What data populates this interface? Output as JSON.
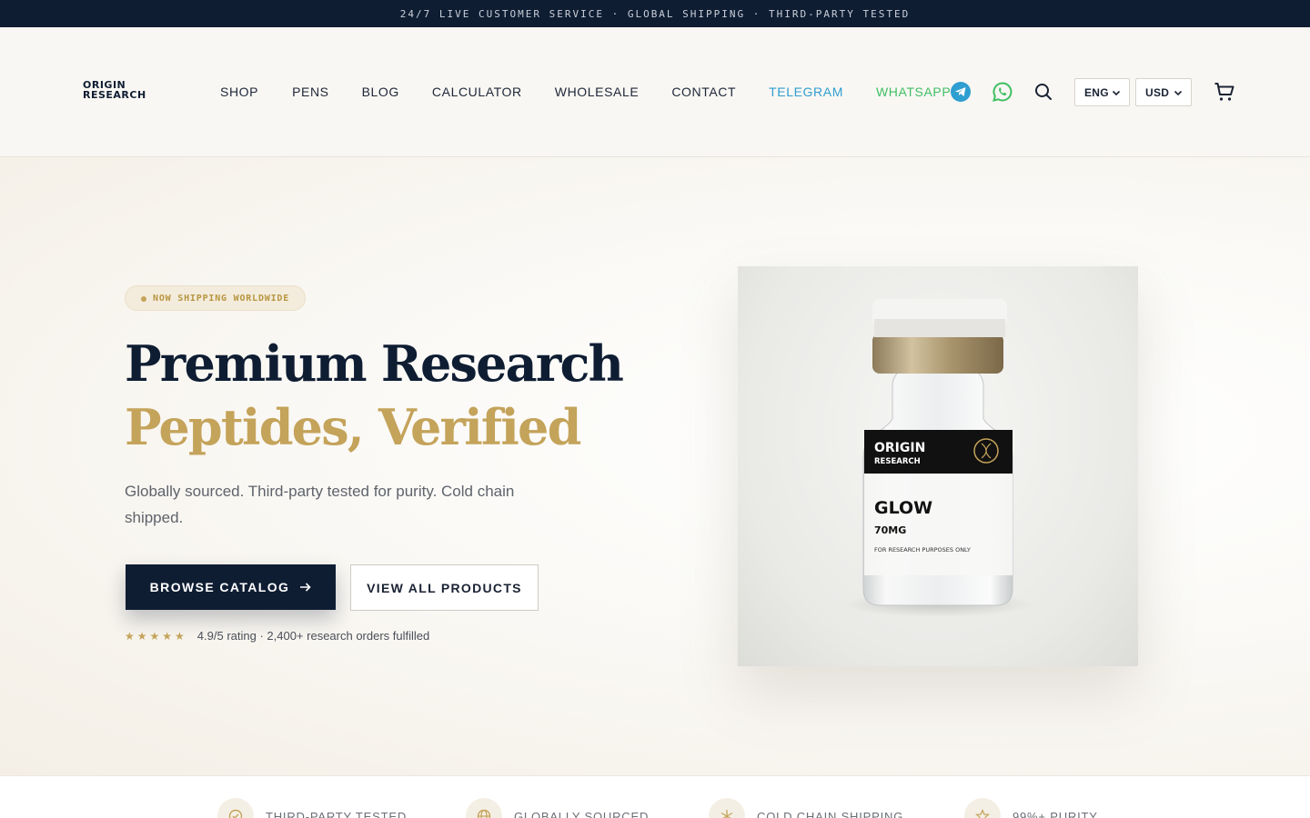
{
  "topbar": {
    "text": "24/7 LIVE CUSTOMER SERVICE · GLOBAL SHIPPING · THIRD-PARTY TESTED"
  },
  "brand": {
    "line1": "ORIGIN",
    "line2": "RESEARCH"
  },
  "nav": [
    {
      "label": "SHOP"
    },
    {
      "label": "PENS"
    },
    {
      "label": "BLOG"
    },
    {
      "label": "CALCULATOR"
    },
    {
      "label": "WHOLESALE"
    },
    {
      "label": "CONTACT"
    },
    {
      "label": "TELEGRAM",
      "color": "#2f9ed0"
    },
    {
      "label": "WHATSAPP",
      "color": "#3fbf63"
    }
  ],
  "header_icons": {
    "telegram": "telegram-icon",
    "whatsapp": "whatsapp-icon",
    "search": "search-icon",
    "cart": "cart-icon"
  },
  "language": {
    "value": "ENG"
  },
  "currency": {
    "value": "USD"
  },
  "hero": {
    "badge": "NOW SHIPPING WORLDWIDE",
    "title_line1": "Premium Research",
    "title_line2": "Peptides, Verified",
    "subtitle": "Globally sourced. Third-party tested for purity. Cold chain shipped.",
    "primary_cta": "BROWSE CATALOG",
    "secondary_cta": "VIEW ALL PRODUCTS",
    "stars": "★★★★★",
    "rating_text": "4.9/5 rating · 2,400+ research orders fulfilled"
  },
  "product_label": {
    "brand1": "ORIGIN",
    "brand2": "RESEARCH",
    "name": "GLOW",
    "dose": "70MG",
    "note": "FOR RESEARCH PURPOSES ONLY"
  },
  "features": [
    {
      "label": "THIRD-PARTY TESTED",
      "icon": "check-badge-icon"
    },
    {
      "label": "GLOBALLY SOURCED",
      "icon": "globe-icon"
    },
    {
      "label": "COLD CHAIN SHIPPING",
      "icon": "snowflake-icon"
    },
    {
      "label": "99%+ PURITY",
      "icon": "star-icon"
    }
  ],
  "colors": {
    "navy": "#0f1d33",
    "gold": "#c4a35a",
    "telegram": "#2f9ed0",
    "whatsapp": "#3fbf63"
  }
}
